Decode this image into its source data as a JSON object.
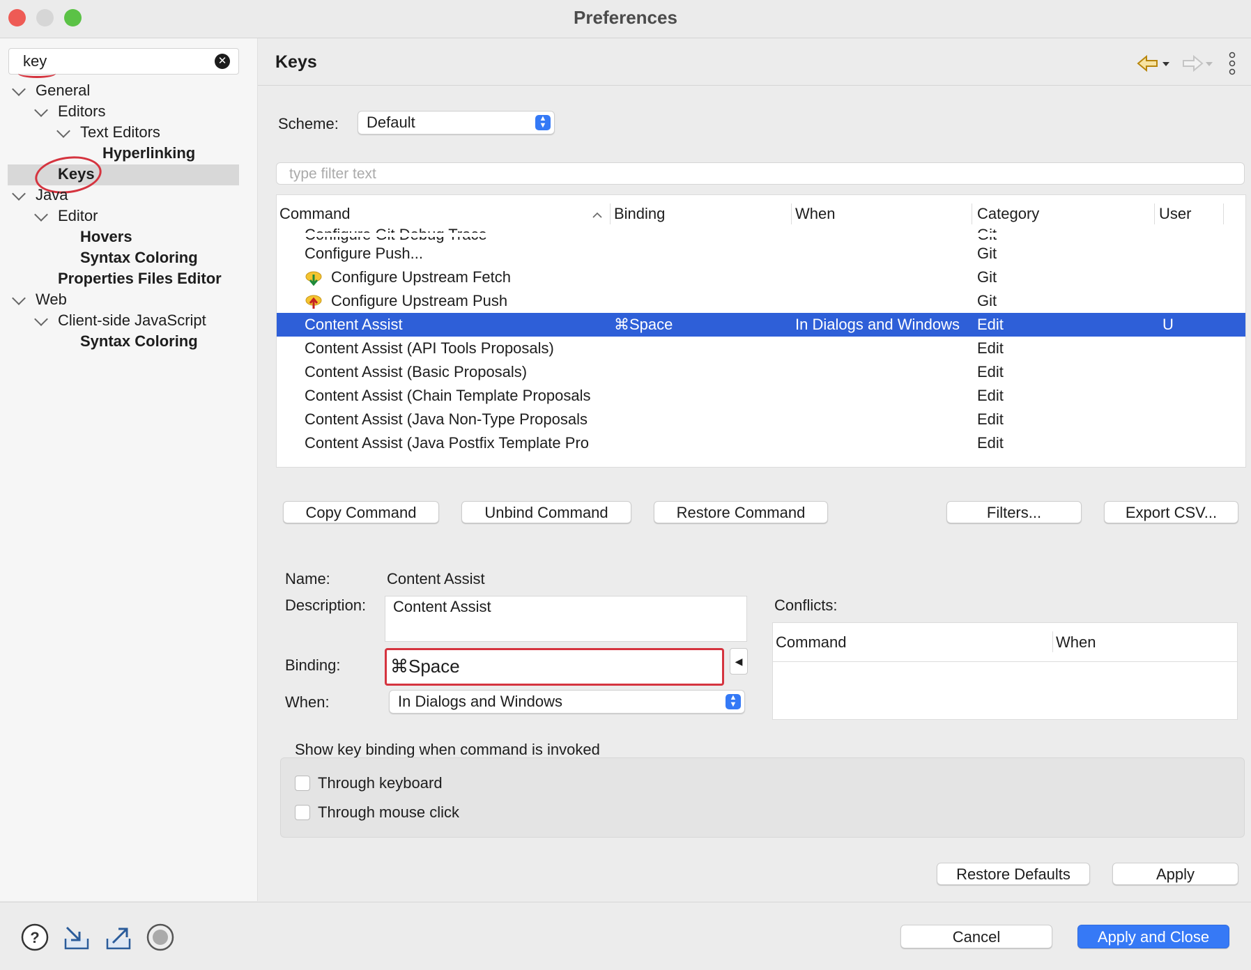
{
  "window": {
    "title": "Preferences"
  },
  "sidebar": {
    "search_value": "key",
    "tree": [
      {
        "label": "General"
      },
      {
        "label": "Editors"
      },
      {
        "label": "Text Editors"
      },
      {
        "label": "Hyperlinking"
      },
      {
        "label": "Keys"
      },
      {
        "label": "Java"
      },
      {
        "label": "Editor"
      },
      {
        "label": "Hovers"
      },
      {
        "label": "Syntax Coloring"
      },
      {
        "label": "Properties Files Editor"
      },
      {
        "label": "Web"
      },
      {
        "label": "Client-side JavaScript"
      },
      {
        "label": "Syntax Coloring"
      }
    ]
  },
  "page": {
    "title": "Keys",
    "scheme_label": "Scheme:",
    "scheme_value": "Default",
    "filter_placeholder": "type filter text",
    "table": {
      "columns": [
        "Command",
        "Binding",
        "When",
        "Category",
        "User"
      ],
      "rows": [
        {
          "command": "Configure Git Debug Trace",
          "binding": "",
          "when": "",
          "category": "Git",
          "user": ""
        },
        {
          "command": "Configure Push...",
          "binding": "",
          "when": "",
          "category": "Git",
          "user": ""
        },
        {
          "command": "Configure Upstream Fetch",
          "binding": "",
          "when": "",
          "category": "Git",
          "user": ""
        },
        {
          "command": "Configure Upstream Push",
          "binding": "",
          "when": "",
          "category": "Git",
          "user": ""
        },
        {
          "command": "Content Assist",
          "binding": "⌘Space",
          "when": "In Dialogs and Windows",
          "category": "Edit",
          "user": "U"
        },
        {
          "command": "Content Assist (API Tools Proposals)",
          "binding": "",
          "when": "",
          "category": "Edit",
          "user": ""
        },
        {
          "command": "Content Assist (Basic Proposals)",
          "binding": "",
          "when": "",
          "category": "Edit",
          "user": ""
        },
        {
          "command": "Content Assist (Chain Template Proposals",
          "binding": "",
          "when": "",
          "category": "Edit",
          "user": ""
        },
        {
          "command": "Content Assist (Java Non-Type Proposals",
          "binding": "",
          "when": "",
          "category": "Edit",
          "user": ""
        },
        {
          "command": "Content Assist (Java Postfix Template Pro",
          "binding": "",
          "when": "",
          "category": "Edit",
          "user": ""
        }
      ]
    },
    "buttons": {
      "copy": "Copy Command",
      "unbind": "Unbind Command",
      "restore": "Restore Command",
      "filters": "Filters...",
      "export": "Export CSV..."
    },
    "details": {
      "name_label": "Name:",
      "name_value": "Content Assist",
      "description_label": "Description:",
      "description_value": "Content Assist",
      "binding_label": "Binding:",
      "binding_value": "⌘Space",
      "when_label": "When:",
      "when_value": "In Dialogs and Windows",
      "conflicts_label": "Conflicts:",
      "conflicts_columns": [
        "Command",
        "When"
      ]
    },
    "show_binding": {
      "title": "Show key binding when command is invoked",
      "through_keyboard": "Through keyboard",
      "through_mouse": "Through mouse click"
    },
    "restore_defaults": "Restore Defaults",
    "apply": "Apply"
  },
  "footer": {
    "cancel": "Cancel",
    "apply_close": "Apply and Close"
  },
  "colors": {
    "selection": "#2e5fd8",
    "accent": "#3679f6",
    "annotation": "#d5343f"
  }
}
